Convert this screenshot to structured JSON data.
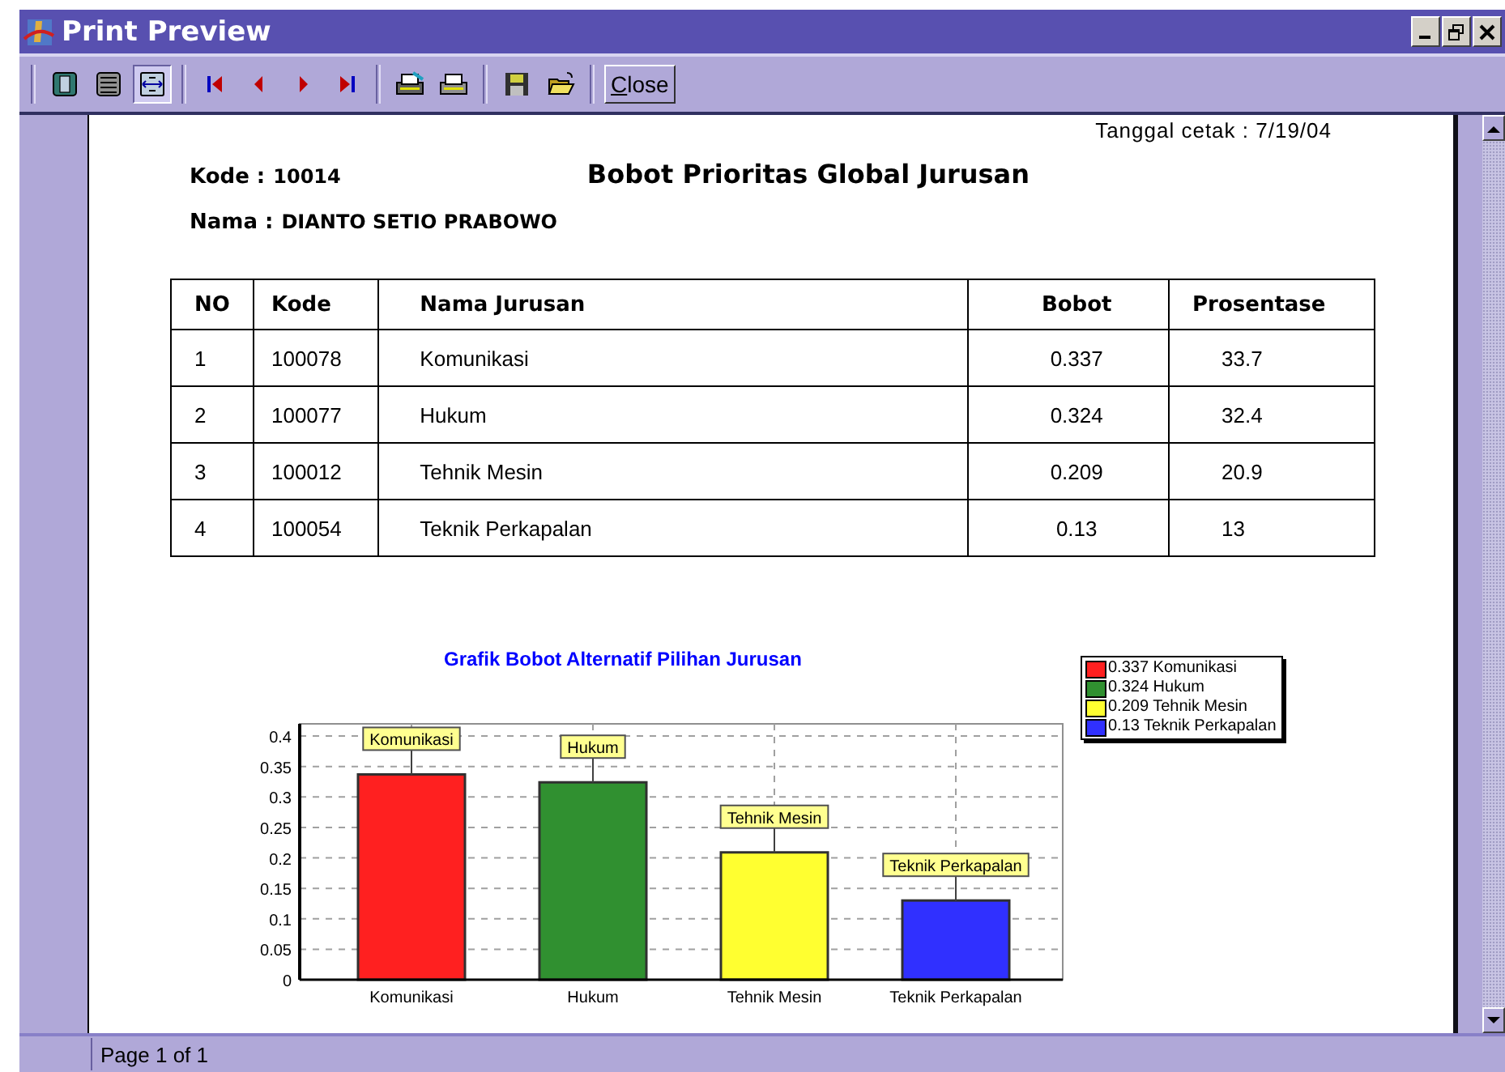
{
  "window": {
    "title": "Print Preview"
  },
  "toolbar": {
    "view_buttons": [
      {
        "selected": false
      },
      {
        "selected": false
      },
      {
        "selected": true
      }
    ],
    "close_button": "Close"
  },
  "report": {
    "printed_date": "Tanggal cetak : 7/19/04",
    "title": "Bobot Prioritas Global Jurusan",
    "kode_label": "Kode :",
    "kode_value": "10014",
    "nama_label": "Nama :",
    "nama_value": "DIANTO SETIO PRABOWO",
    "table": {
      "columns": [
        "NO",
        "Kode",
        "Nama Jurusan",
        "Bobot",
        "Prosentase"
      ],
      "rows": [
        [
          "1",
          "100078",
          "Komunikasi",
          "0.337",
          "33.7"
        ],
        [
          "2",
          "100077",
          "Hukum",
          "0.324",
          "32.4"
        ],
        [
          "3",
          "100012",
          "Tehnik Mesin",
          "0.209",
          "20.9"
        ],
        [
          "4",
          "100054",
          "Teknik Perkapalan",
          "0.13",
          "13"
        ]
      ]
    },
    "chart": {
      "chart_data": {
        "type": "bar",
        "title": "Grafik Bobot Alternatif Pilihan Jurusan",
        "categories": [
          "Komunikasi",
          "Hukum",
          "Tehnik Mesin",
          "Teknik Perkapalan"
        ],
        "values": [
          0.337,
          0.324,
          0.209,
          0.13
        ],
        "grid": true,
        "ylim": [
          0,
          0.42
        ],
        "yticks": [
          0,
          {
            "value": 0.05,
            "label": "0.05"
          },
          {
            "value": 0.1,
            "label": "0.1"
          },
          {
            "value": 0.15,
            "label": "0.15"
          },
          {
            "value": 0.2,
            "label": "0.2"
          },
          {
            "value": 0.25,
            "label": "0.25"
          },
          {
            "value": 0.3,
            "label": "0.3"
          },
          {
            "value": 0.35,
            "label": "0.35"
          },
          {
            "value": 0.4,
            "label": "0.4"
          }
        ],
        "annotations": [
          {
            "text": "Komunikasi"
          },
          {
            "text": "Hukum"
          },
          {
            "text": "Tehnik Mesin"
          },
          {
            "text": "Teknik Perkapalan"
          }
        ]
      },
      "legend": [
        {
          "label": "0.337 Komunikasi",
          "color": "#ff2020"
        },
        {
          "label": "0.324 Hukum",
          "color": "#309030"
        },
        {
          "label": "0.209 Tehnik Mesin",
          "color": "#ffff30"
        },
        {
          "label": "0.13 Teknik Perkapalan",
          "color": "#3030ff"
        }
      ]
    }
  },
  "status_bar": {
    "page": "Page 1 of 1"
  }
}
